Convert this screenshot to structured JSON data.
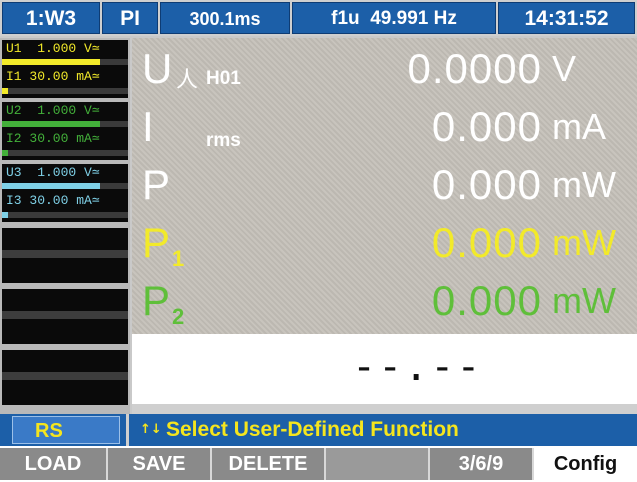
{
  "status_bar": {
    "wiring": "1:W3",
    "mode": "PI",
    "update_rate": "300.1ms",
    "freq_label": "f1u",
    "freq_value": "49.991 Hz",
    "clock": "14:31:52"
  },
  "channels": [
    {
      "v_label": "U1  1.000 V≃",
      "i_label": "I1 30.00 mA≃",
      "color": "#f2ea2a",
      "v_level": 0.78,
      "i_level": 0.05
    },
    {
      "v_label": "U2  1.000 V≃",
      "i_label": "I2 30.00 mA≃",
      "color": "#43b03a",
      "v_level": 0.78,
      "i_level": 0.05
    },
    {
      "v_label": "U3  1.000 V≃",
      "i_label": "I3 30.00 mA≃",
      "color": "#7fd0e6",
      "v_level": 0.78,
      "i_level": 0.05
    }
  ],
  "measurements": [
    {
      "symbol": "U",
      "wiring_glyph": "人",
      "sub": "H01",
      "value": "0.0000",
      "unit": "V",
      "color": "#ffffff"
    },
    {
      "symbol": "I",
      "sub": "rms",
      "value": "0.000",
      "unit": "mA",
      "color": "#ffffff"
    },
    {
      "symbol": "P",
      "sub": "",
      "value": "0.000",
      "unit": "mW",
      "color": "#ffffff"
    },
    {
      "symbol": "P",
      "sub": "1",
      "value": "0.000",
      "unit": "mW",
      "color": "#f2ea2a"
    },
    {
      "symbol": "P",
      "sub": "2",
      "value": "0.000",
      "unit": "mW",
      "color": "#5fbf3a"
    }
  ],
  "function_value": "--.--",
  "message_bar": {
    "rs_label": "RS",
    "arrows": "↑↓",
    "message": "Select User-Defined Function"
  },
  "softkeys": {
    "load": "LOAD",
    "save": "SAVE",
    "delete": "DELETE",
    "blank": "",
    "page": "3/6/9",
    "config": "Config"
  },
  "colors": {
    "bar_blue": "#1c5fa8",
    "accent_yellow": "#f5e51e"
  }
}
